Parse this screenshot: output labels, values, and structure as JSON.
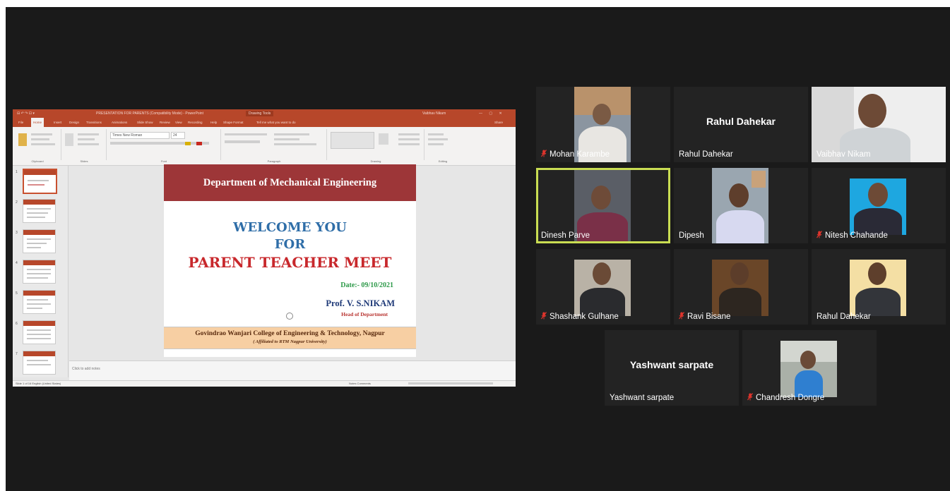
{
  "powerpoint": {
    "quick_access": "⊟ ↶ ↷ ⊡ ▾",
    "document_title": "PRESENTATION FOR PARENTS (Compatibility Mode) - PowerPoint",
    "contextual_tab": "Drawing Tools",
    "user": "Vaibhav Nikam",
    "window_controls": "— ▢ ✕",
    "tabs": [
      "File",
      "Home",
      "Insert",
      "Design",
      "Transitions",
      "Animations",
      "Slide Show",
      "Review",
      "View",
      "Recording",
      "Help",
      "Shape Format"
    ],
    "tell_me": "Tell me what you want to do",
    "share": "Share",
    "ribbon_groups": [
      "Clipboard",
      "Slides",
      "Font",
      "Paragraph",
      "Drawing",
      "Editing"
    ],
    "font_name": "Times New Roman",
    "font_size": "24",
    "notes_placeholder": "Click to add notes",
    "status_left": "Slide 1 of 16    English (United States)",
    "status_right": "Notes    Comments",
    "thumbnail_numbers": [
      "1",
      "2",
      "3",
      "4",
      "5",
      "6",
      "7"
    ]
  },
  "slide": {
    "header": "Department of Mechanical Engineering",
    "line1": "WELCOME YOU",
    "line2": "FOR",
    "line3": "PARENT TEACHER MEET",
    "date": "Date:- 09/10/2021",
    "professor": "Prof. V. S.NIKAM",
    "role": "Head of Department",
    "college": "Govindrao Wanjari College of Engineering & Technology, Nagpur",
    "affiliation": "( Affiliated to RTM Nagpur University)"
  },
  "participants": [
    {
      "name": "Mohan Karambe",
      "muted": true,
      "video": true
    },
    {
      "name": "Rahul Dahekar",
      "display": "Rahul Dahekar",
      "muted": false,
      "video": false
    },
    {
      "name": "Vaibhav Nikam",
      "muted": false,
      "video": true
    },
    {
      "name": "Dinesh Parve",
      "muted": false,
      "video": true,
      "active_speaker": true
    },
    {
      "name": "Dipesh",
      "muted": false,
      "video": true
    },
    {
      "name": "Nitesh Chahande",
      "muted": true,
      "video": true
    },
    {
      "name": "Shashank Gulhane",
      "muted": true,
      "video": true
    },
    {
      "name": "Ravi Bisane",
      "muted": true,
      "video": true
    },
    {
      "name": "Rahul Dahekar",
      "muted": false,
      "video": true
    },
    {
      "name": "Yashwant sarpate",
      "display": "Yashwant sarpate",
      "muted": false,
      "video": false
    },
    {
      "name": "Chandresh Dongre",
      "muted": true,
      "video": true
    }
  ],
  "colors": {
    "meeting_bg": "#1a1a1a",
    "tile_bg": "#232323",
    "active_speaker_border": "#c9dd52",
    "muted_icon": "#e0342c",
    "ppt_accent": "#b7472a"
  }
}
